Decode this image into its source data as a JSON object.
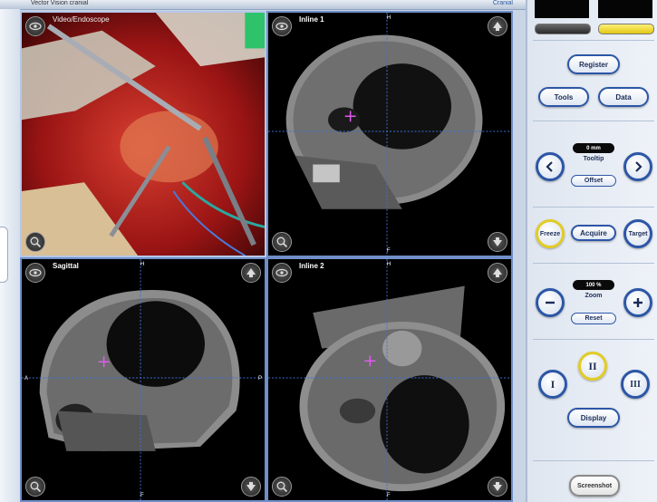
{
  "window": {
    "title": "Vector Vision cranial",
    "right_label": "Cranial"
  },
  "panes": {
    "video": {
      "label": "Video/Endoscope"
    },
    "inline1": {
      "label": "Inline 1",
      "top_mark": "H",
      "bottom_mark": "F"
    },
    "sagittal": {
      "label": "Sagittal",
      "top_mark": "H",
      "bottom_mark": "F",
      "left_mark": "A",
      "right_mark": "P"
    },
    "inline2": {
      "label": "Inline 2",
      "top_mark": "H",
      "bottom_mark": "F"
    }
  },
  "panel": {
    "register": "Register",
    "tools": "Tools",
    "data": "Data",
    "tooltip_value": "0 mm",
    "tooltip_caption": "Tooltip",
    "offset": "Offset",
    "freeze": "Freeze",
    "acquire": "Acquire",
    "target": "Target",
    "zoom_value": "100 %",
    "zoom_caption": "Zoom",
    "reset": "Reset",
    "layout_1": "I",
    "layout_2": "II",
    "layout_3": "III",
    "display": "Display",
    "screenshot": "Screenshot",
    "indicator_left": "#3a3a3a",
    "indicator_right": "#f2dc1c"
  },
  "icons": [
    "eye-icon",
    "arrow-up-icon",
    "zoom-icon",
    "arrow-down-icon",
    "chevron-left-icon",
    "chevron-right-icon",
    "minus-icon",
    "plus-icon"
  ],
  "colors": {
    "accent_blue": "#2c56a6",
    "highlight_yellow": "#e2cc24",
    "crosshair": "#e05cf0"
  }
}
